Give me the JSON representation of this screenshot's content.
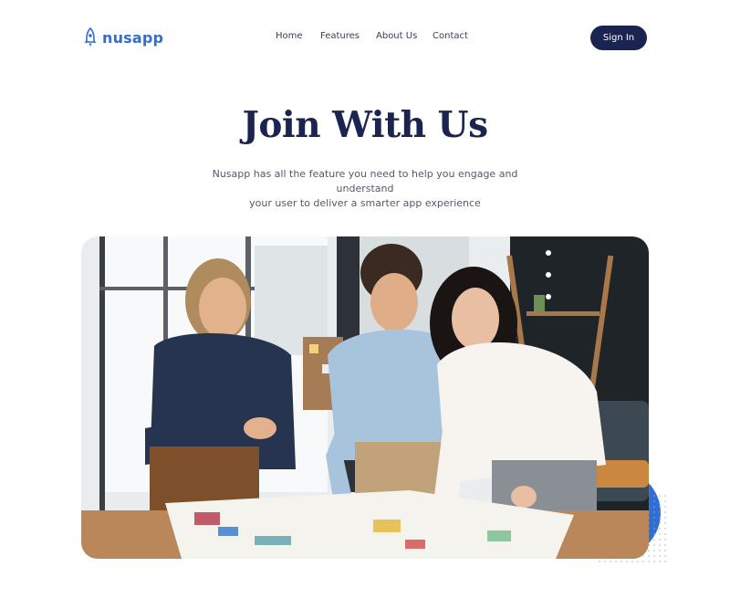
{
  "brand": {
    "name": "nusapp",
    "icon": "rocket-icon",
    "color": "#2f6fd1"
  },
  "nav": {
    "home": "Home",
    "features": "Features",
    "about": "About Us",
    "contact": "Contact"
  },
  "header": {
    "signin_label": "Sign In"
  },
  "hero": {
    "title": "Join With Us",
    "subtitle_line1": "Nusapp has all the feature you need to help you engage and understand",
    "subtitle_line2": "your user to deliver a smarter app experience"
  },
  "colors": {
    "navy": "#1b2450",
    "accent": "#2f6fd1",
    "text_muted": "#55596b"
  }
}
